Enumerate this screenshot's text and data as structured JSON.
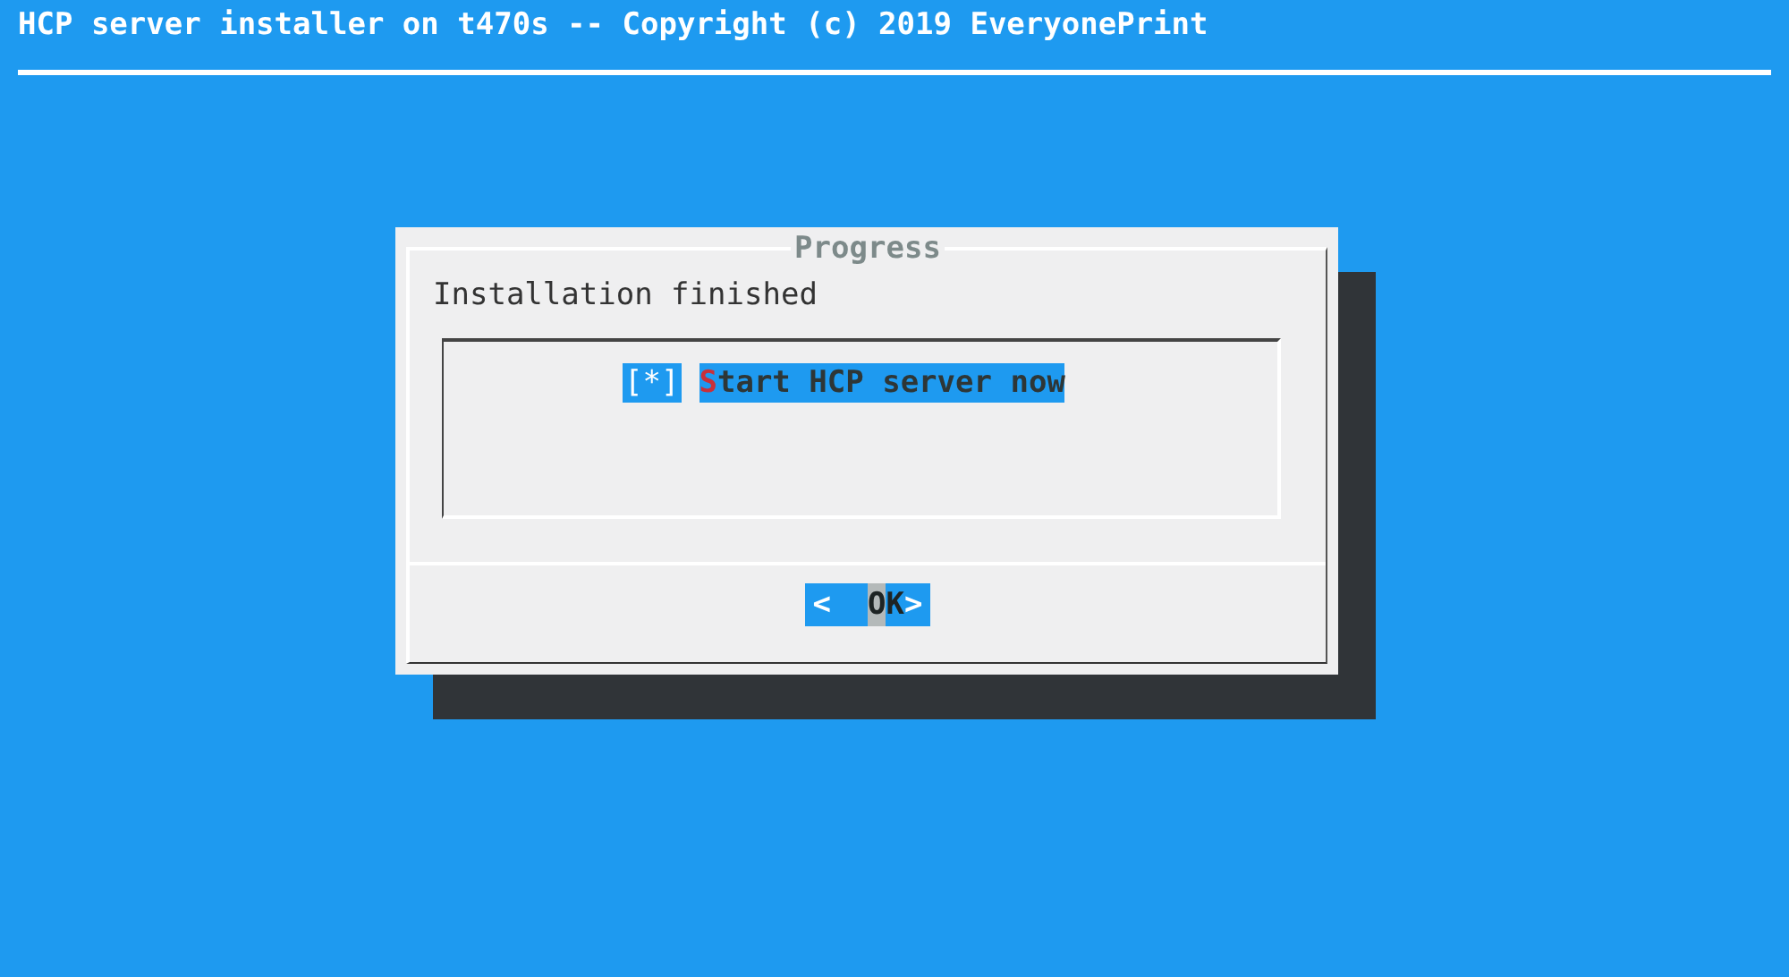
{
  "header": {
    "title": "HCP server installer on t470s -- Copyright (c) 2019 EveryonePrint"
  },
  "dialog": {
    "title": "Progress",
    "message": "Installation finished",
    "items": [
      {
        "mark": "[*]",
        "label": "Start HCP server now",
        "checked": true,
        "selected": true
      }
    ],
    "buttons": [
      {
        "open": "<",
        "label": "OK",
        "close": ">",
        "selected": true
      }
    ]
  }
}
